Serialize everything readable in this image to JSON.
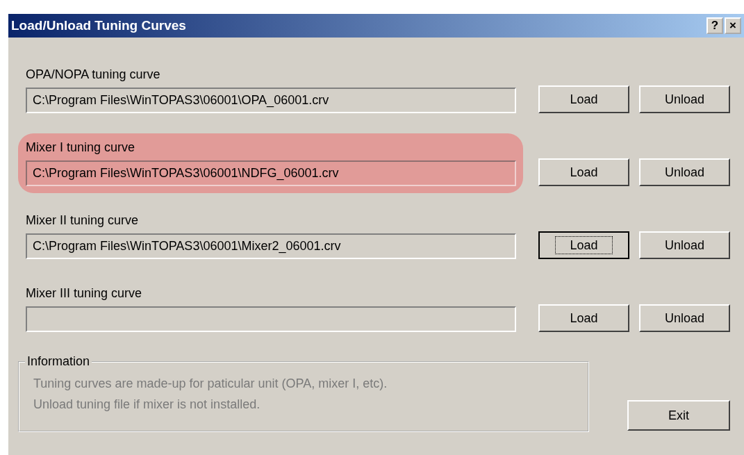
{
  "window": {
    "title": "Load/Unload Tuning Curves",
    "title_buttons": [
      "?",
      "×"
    ]
  },
  "curves": [
    {
      "label": "OPA/NOPA tuning curve",
      "path": "C:\\Program Files\\WinTOPAS3\\06001\\OPA_06001.crv",
      "highlighted": false,
      "load": {
        "label": "Load",
        "focused": false
      },
      "unload": {
        "label": "Unload"
      }
    },
    {
      "label": "Mixer I tuning curve",
      "path": "C:\\Program Files\\WinTOPAS3\\06001\\NDFG_06001.crv",
      "highlighted": true,
      "load": {
        "label": "Load",
        "focused": false
      },
      "unload": {
        "label": "Unload"
      }
    },
    {
      "label": "Mixer II tuning curve",
      "path": "C:\\Program Files\\WinTOPAS3\\06001\\Mixer2_06001.crv",
      "highlighted": false,
      "load": {
        "label": "Load",
        "focused": true
      },
      "unload": {
        "label": "Unload"
      }
    },
    {
      "label": "Mixer III tuning curve",
      "highlighted": false,
      "load": {
        "label": "Load",
        "focused": false
      },
      "unload": {
        "label": "Unload"
      }
    }
  ],
  "information": {
    "title": "Information",
    "lines": [
      "Tuning curves are made-up for paticular unit (OPA, mixer I, etc).",
      "Unload tuning file if mixer is not installed."
    ]
  },
  "exit_button": "Exit"
}
